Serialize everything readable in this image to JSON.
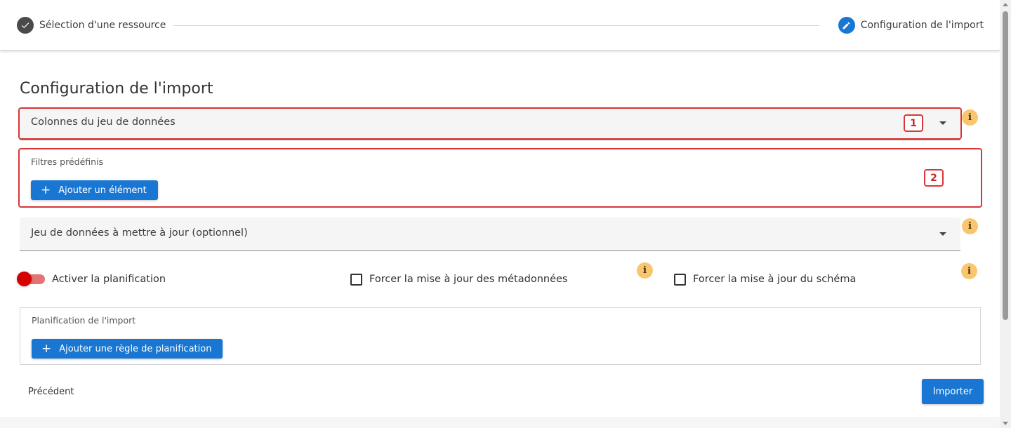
{
  "stepper": {
    "steps": [
      {
        "label": "Sélection d'une ressource",
        "icon": "check-icon",
        "state": "completed",
        "color": "#4a4a4a"
      },
      {
        "label": "Configuration de l'import",
        "icon": "pencil-icon",
        "state": "active",
        "color": "#1976d2"
      }
    ]
  },
  "main": {
    "title": "Configuration de l'import",
    "columns_select": {
      "label": "Colonnes du jeu de données",
      "value": ""
    },
    "filters": {
      "label": "Filtres prédéfinis",
      "add_button": "Ajouter un élément"
    },
    "dataset_update_select": {
      "label": "Jeu de données à mettre à jour (optionnel)",
      "value": ""
    },
    "schedule_toggle": {
      "label": "Activer la planification",
      "checked": false,
      "color": "#d50000"
    },
    "force_metadata": {
      "label": "Forcer la mise à jour des métadonnées",
      "checked": false
    },
    "force_schema": {
      "label": "Forcer la mise à jour du schéma",
      "checked": false
    },
    "schedule_panel": {
      "label": "Planification de l'import",
      "add_button": "Ajouter une règle de planification"
    },
    "info_icon_text": "i"
  },
  "annotations": {
    "tag_1": "1",
    "tag_2": "2",
    "color": "#d93636"
  },
  "footer": {
    "prev_button": "Précédent",
    "import_button": "Importer"
  },
  "colors": {
    "primary": "#1976d2",
    "info_badge": "#f9c66f"
  }
}
